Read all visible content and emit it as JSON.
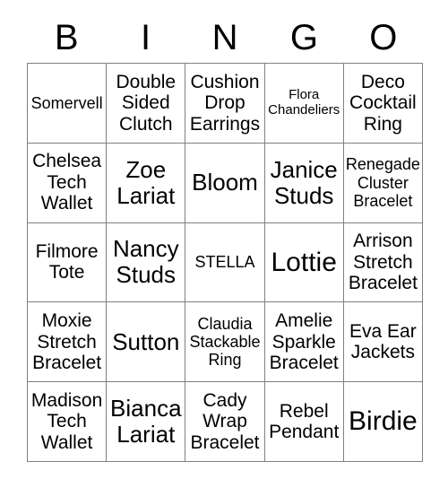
{
  "header": {
    "letters": [
      "B",
      "I",
      "N",
      "G",
      "O"
    ]
  },
  "grid": {
    "columns": 5,
    "rows": 5,
    "border_color": "#808080",
    "background_color": "#ffffff",
    "text_color": "#000000",
    "cells": [
      {
        "text": "Somervell",
        "size": "sm"
      },
      {
        "text": "Double Sided Clutch",
        "size": "md"
      },
      {
        "text": "Cushion Drop Earrings",
        "size": "md"
      },
      {
        "text": "Flora Chandeliers",
        "size": "xs"
      },
      {
        "text": "Deco Cocktail Ring",
        "size": "md"
      },
      {
        "text": "Chelsea Tech Wallet",
        "size": "md"
      },
      {
        "text": "Zoe Lariat",
        "size": "lg"
      },
      {
        "text": "Bloom",
        "size": "lg"
      },
      {
        "text": "Janice Studs",
        "size": "lg"
      },
      {
        "text": "Renegade Cluster Bracelet",
        "size": "sm"
      },
      {
        "text": "Filmore Tote",
        "size": "md"
      },
      {
        "text": "Nancy Studs",
        "size": "lg"
      },
      {
        "text": "STELLA",
        "size": "sm"
      },
      {
        "text": "Lottie",
        "size": "xl"
      },
      {
        "text": "Arrison Stretch Bracelet",
        "size": "md"
      },
      {
        "text": "Moxie Stretch Bracelet",
        "size": "md"
      },
      {
        "text": "Sutton",
        "size": "lg"
      },
      {
        "text": "Claudia Stackable Ring",
        "size": "sm"
      },
      {
        "text": "Amelie Sparkle Bracelet",
        "size": "md"
      },
      {
        "text": "Eva Ear Jackets",
        "size": "md"
      },
      {
        "text": "Madison Tech Wallet",
        "size": "md"
      },
      {
        "text": "Bianca Lariat",
        "size": "lg"
      },
      {
        "text": "Cady Wrap Bracelet",
        "size": "md"
      },
      {
        "text": "Rebel Pendant",
        "size": "md"
      },
      {
        "text": "Birdie",
        "size": "xl"
      }
    ]
  }
}
